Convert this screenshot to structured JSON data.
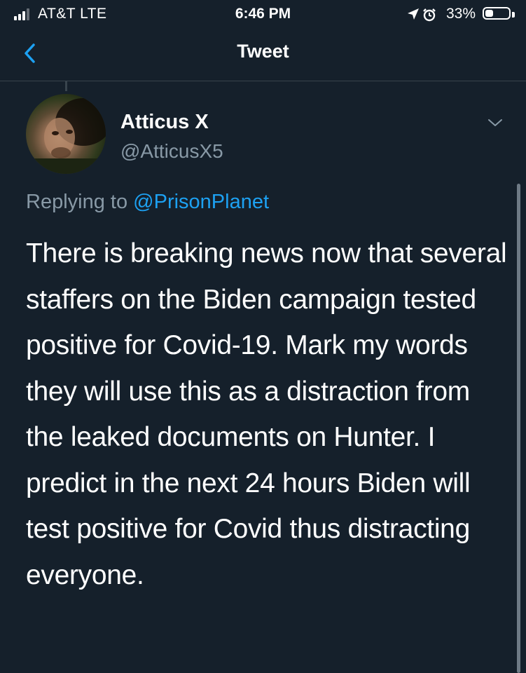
{
  "status_bar": {
    "carrier": "AT&T  LTE",
    "time": "6:46 PM",
    "battery": "33%",
    "battery_level": 0.33,
    "icons": [
      "signal-icon",
      "location-icon",
      "alarm-icon",
      "battery-icon"
    ]
  },
  "nav": {
    "title": "Tweet",
    "back_icon": "chevron-left-icon"
  },
  "tweet": {
    "display_name": "Atticus X",
    "username": "@AtticusX5",
    "replying_prefix": "Replying to ",
    "replying_to": "@PrisonPlanet",
    "text": "There is breaking news now that several staffers on the Biden campaign tested positive for Covid-19. Mark my words they will use this as a distraction from the leaked documents on Hunter. I predict in the next 24 hours Biden will test positive for Covid thus distracting everyone.",
    "more_icon": "chevron-down-icon"
  },
  "colors": {
    "background": "#15202b",
    "text": "#ffffff",
    "secondary_text": "#8899a6",
    "accent": "#1da1f2",
    "divider": "#38444d"
  }
}
